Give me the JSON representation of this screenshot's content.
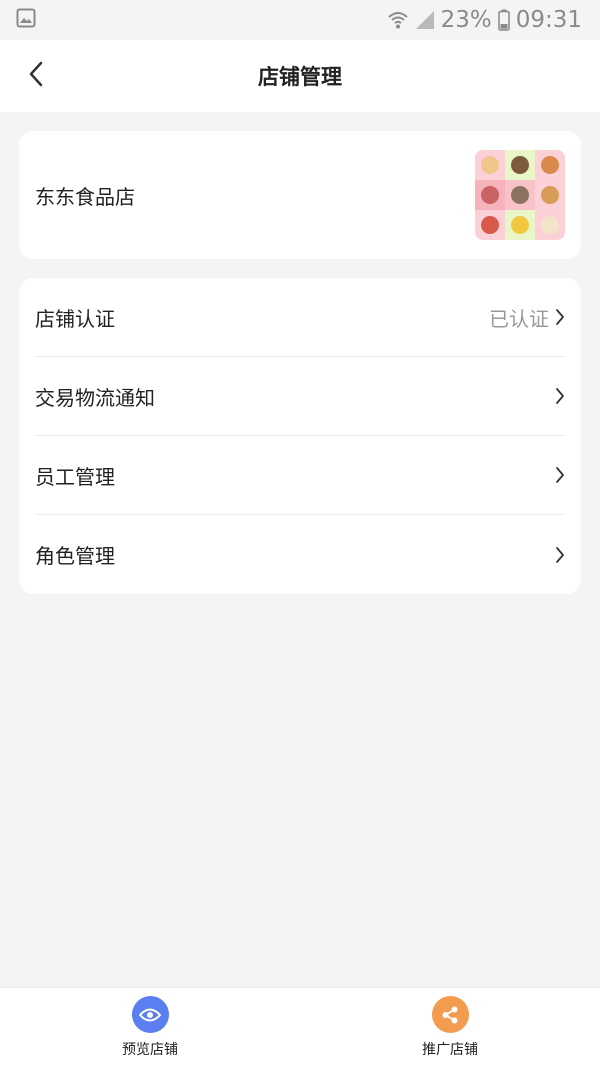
{
  "status_bar": {
    "battery": "23%",
    "time": "09:31",
    "icons": [
      "gallery-icon",
      "wifi-icon",
      "signal-icon",
      "battery-icon"
    ]
  },
  "header": {
    "title": "店铺管理",
    "back_icon": "chevron-left-icon"
  },
  "store": {
    "name": "东东食品店",
    "logo_icon": "store-logo-food-collage"
  },
  "menu": {
    "items": [
      {
        "label": "店铺认证",
        "value": "已认证"
      },
      {
        "label": "交易物流通知",
        "value": ""
      },
      {
        "label": "员工管理",
        "value": ""
      },
      {
        "label": "角色管理",
        "value": ""
      }
    ]
  },
  "bottom_bar": {
    "preview": {
      "label": "预览店铺",
      "icon": "eye-icon",
      "color": "#5b7ef0"
    },
    "promote": {
      "label": "推广店铺",
      "icon": "share-icon",
      "color": "#f39b4e"
    }
  }
}
